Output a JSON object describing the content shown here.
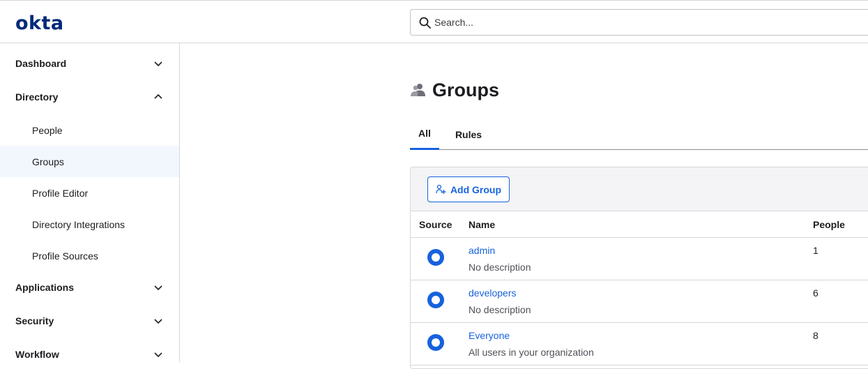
{
  "header": {
    "logo": "okta",
    "search_placeholder": "Search..."
  },
  "sidebar": {
    "sections": [
      {
        "label": "Dashboard",
        "expanded": false
      },
      {
        "label": "Directory",
        "expanded": true
      },
      {
        "label": "Applications",
        "expanded": false
      },
      {
        "label": "Security",
        "expanded": false
      },
      {
        "label": "Workflow",
        "expanded": false
      }
    ],
    "directory_items": [
      {
        "label": "People",
        "active": false
      },
      {
        "label": "Groups",
        "active": true
      },
      {
        "label": "Profile Editor",
        "active": false
      },
      {
        "label": "Directory Integrations",
        "active": false
      },
      {
        "label": "Profile Sources",
        "active": false
      }
    ]
  },
  "main": {
    "title": "Groups",
    "title_icon": "groups-icon",
    "tabs": [
      {
        "label": "All",
        "active": true
      },
      {
        "label": "Rules",
        "active": false
      }
    ],
    "add_button": "Add Group",
    "columns": {
      "source": "Source",
      "name": "Name",
      "people": "People"
    },
    "groups": [
      {
        "name": "admin",
        "description": "No description",
        "people": "1",
        "source_icon": "okta-source-icon"
      },
      {
        "name": "developers",
        "description": "No description",
        "people": "6",
        "source_icon": "okta-source-icon"
      },
      {
        "name": "Everyone",
        "description": "All users in your organization",
        "people": "8",
        "source_icon": "okta-source-icon"
      }
    ]
  },
  "colors": {
    "accent": "#1662dd",
    "logo": "#00297a",
    "active_nav_bg": "#f2f7fd"
  }
}
